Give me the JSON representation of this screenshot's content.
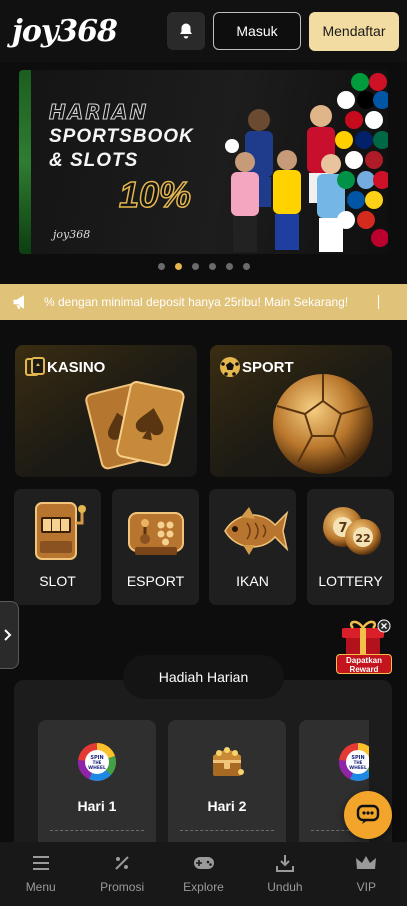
{
  "header": {
    "logo": "joy368",
    "login_label": "Masuk",
    "register_label": "Mendaftar",
    "notification_icon": "bell-icon"
  },
  "banner": {
    "line1": "HARIAN",
    "line2": "SPORTSBOOK",
    "line3": "& SLOTS",
    "percent": "10%",
    "brand": "joy368",
    "active_slide": 2,
    "slide_count": 6
  },
  "marquee": {
    "icon": "megaphone-icon",
    "text": "% dengan minimal deposit hanya 25ribu! Main Sekarang!"
  },
  "categories_main": [
    {
      "label": "KASINO",
      "icon": "cards-icon"
    },
    {
      "label": "SPORT",
      "icon": "soccer-ball-icon"
    }
  ],
  "categories_small": [
    {
      "label": "SLOT",
      "icon": "slot-machine-icon"
    },
    {
      "label": "ESPORT",
      "icon": "arcade-icon"
    },
    {
      "label": "IKAN",
      "icon": "fish-icon"
    },
    {
      "label": "LOTTERY",
      "icon": "lottery-ball-icon"
    }
  ],
  "reward_badge": {
    "line1": "Dapatkan",
    "line2": "Reward"
  },
  "daily": {
    "title": "Hadiah Harian",
    "days": [
      {
        "label": "Hari 1",
        "icon": "spin-wheel-icon",
        "icon_text": "SPIN THE WHEEL"
      },
      {
        "label": "Hari 2",
        "icon": "treasure-chest-icon",
        "icon_text": ""
      },
      {
        "label": "H",
        "icon": "spin-wheel-icon",
        "icon_text": "SPIN THE WHEEL"
      }
    ]
  },
  "nav": [
    {
      "label": "Menu",
      "icon": "menu-icon"
    },
    {
      "label": "Promosi",
      "icon": "percent-icon"
    },
    {
      "label": "Explore",
      "icon": "gamepad-icon"
    },
    {
      "label": "Unduh",
      "icon": "download-icon"
    },
    {
      "label": "VIP",
      "icon": "crown-icon"
    }
  ],
  "colors": {
    "accent_gold": "#e3b64e",
    "register_bg": "#f3dca1",
    "marquee_bg": "#e0c278",
    "chat_orange": "#f2a52a"
  }
}
